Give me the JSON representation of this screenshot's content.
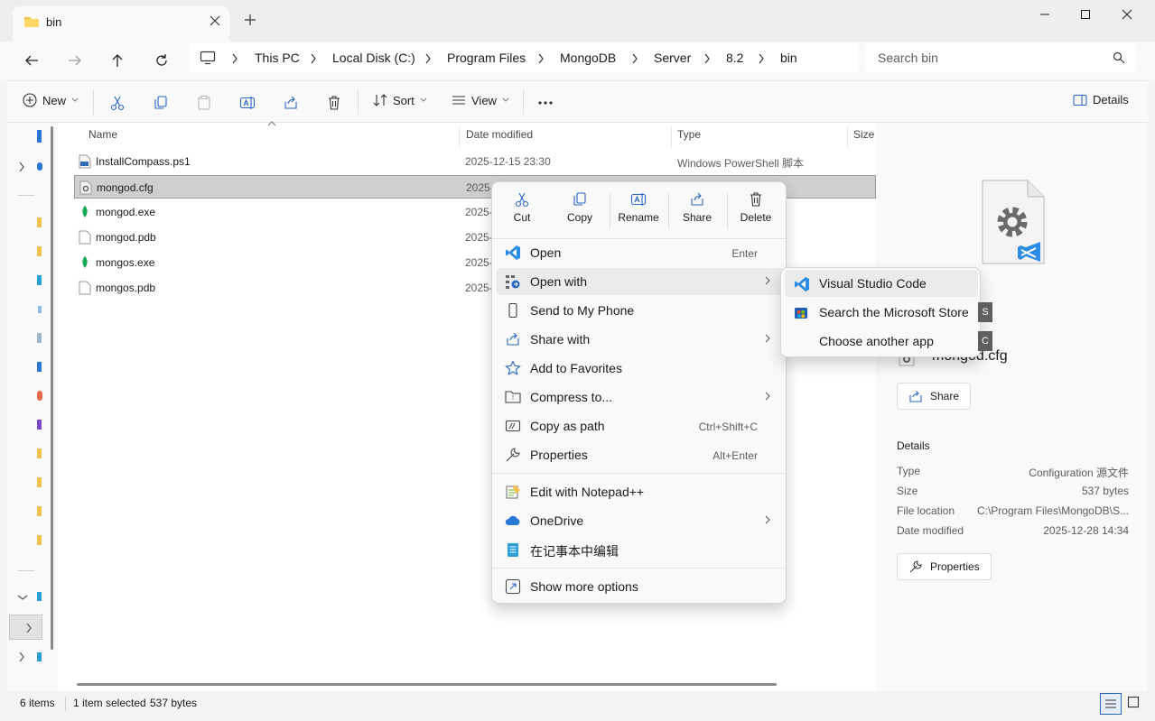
{
  "window": {
    "tab_title": "bin",
    "tab_close_icon": "close-icon",
    "new_tab_icon": "plus-icon"
  },
  "address": {
    "crumbs": [
      "This PC",
      "Local Disk (C:)",
      "Program Files",
      "MongoDB",
      "Server",
      "8.2",
      "bin"
    ],
    "search_placeholder": "Search bin"
  },
  "toolbar": {
    "new_label": "New",
    "sort_label": "Sort",
    "view_label": "View",
    "details_label": "Details"
  },
  "columns": {
    "name": "Name",
    "date": "Date modified",
    "type": "Type",
    "size": "Size"
  },
  "files": [
    {
      "name": "InstallCompass.ps1",
      "date": "2025-12-15 23:30",
      "type": "Windows PowerShell 脚本",
      "icon": "powershell-script-icon"
    },
    {
      "name": "mongod.cfg",
      "date": "2025-",
      "type": "",
      "icon": "config-file-icon",
      "selected": true
    },
    {
      "name": "mongod.exe",
      "date": "2025-",
      "type": "",
      "icon": "mongodb-leaf-icon"
    },
    {
      "name": "mongod.pdb",
      "date": "2025-",
      "type": "",
      "icon": "blank-file-icon"
    },
    {
      "name": "mongos.exe",
      "date": "2025-",
      "type": "",
      "icon": "mongodb-leaf-icon"
    },
    {
      "name": "mongos.pdb",
      "date": "2025-",
      "type": "",
      "icon": "blank-file-icon"
    }
  ],
  "context_menu": {
    "quick_actions": [
      "Cut",
      "Copy",
      "Rename",
      "Share",
      "Delete"
    ],
    "items": [
      {
        "label": "Open",
        "shortcut": "Enter"
      },
      {
        "label": "Open with",
        "shortcut": ""
      },
      {
        "label": "Send to My Phone",
        "shortcut": ""
      },
      {
        "label": "Share with",
        "shortcut": ""
      },
      {
        "label": "Add to Favorites",
        "shortcut": ""
      },
      {
        "label": "Compress to...",
        "shortcut": ""
      },
      {
        "label": "Copy as path",
        "shortcut": "Ctrl+Shift+C"
      },
      {
        "label": "Properties",
        "shortcut": "Alt+Enter"
      },
      {
        "label": "Edit with Notepad++",
        "shortcut": ""
      },
      {
        "label": "OneDrive",
        "shortcut": ""
      },
      {
        "label": "在记事本中编辑",
        "shortcut": ""
      },
      {
        "label": "Show more options",
        "shortcut": ""
      }
    ]
  },
  "submenu": {
    "items": [
      {
        "label": "Visual Studio Code",
        "access_key": ""
      },
      {
        "label": "Search the Microsoft Store",
        "access_key": "S"
      },
      {
        "label": "Choose another app",
        "access_key": "C"
      }
    ]
  },
  "details_pane": {
    "filename": "mongod.cfg",
    "share_label": "Share",
    "section_title": "Details",
    "props": [
      {
        "label": "Type",
        "value": "Configuration 源文件"
      },
      {
        "label": "Size",
        "value": "537 bytes"
      },
      {
        "label": "File location",
        "value": "C:\\Program Files\\MongoDB\\S..."
      },
      {
        "label": "Date modified",
        "value": "2025-12-28 14:34"
      }
    ],
    "properties_label": "Properties"
  },
  "status": {
    "item_count": "6 items",
    "selection": "1 item selected",
    "selection_size": "537 bytes"
  },
  "colors": {
    "accent": "#0067c0",
    "vscode_blue": "#2d8ce6",
    "mongo_green": "#13aa52"
  }
}
